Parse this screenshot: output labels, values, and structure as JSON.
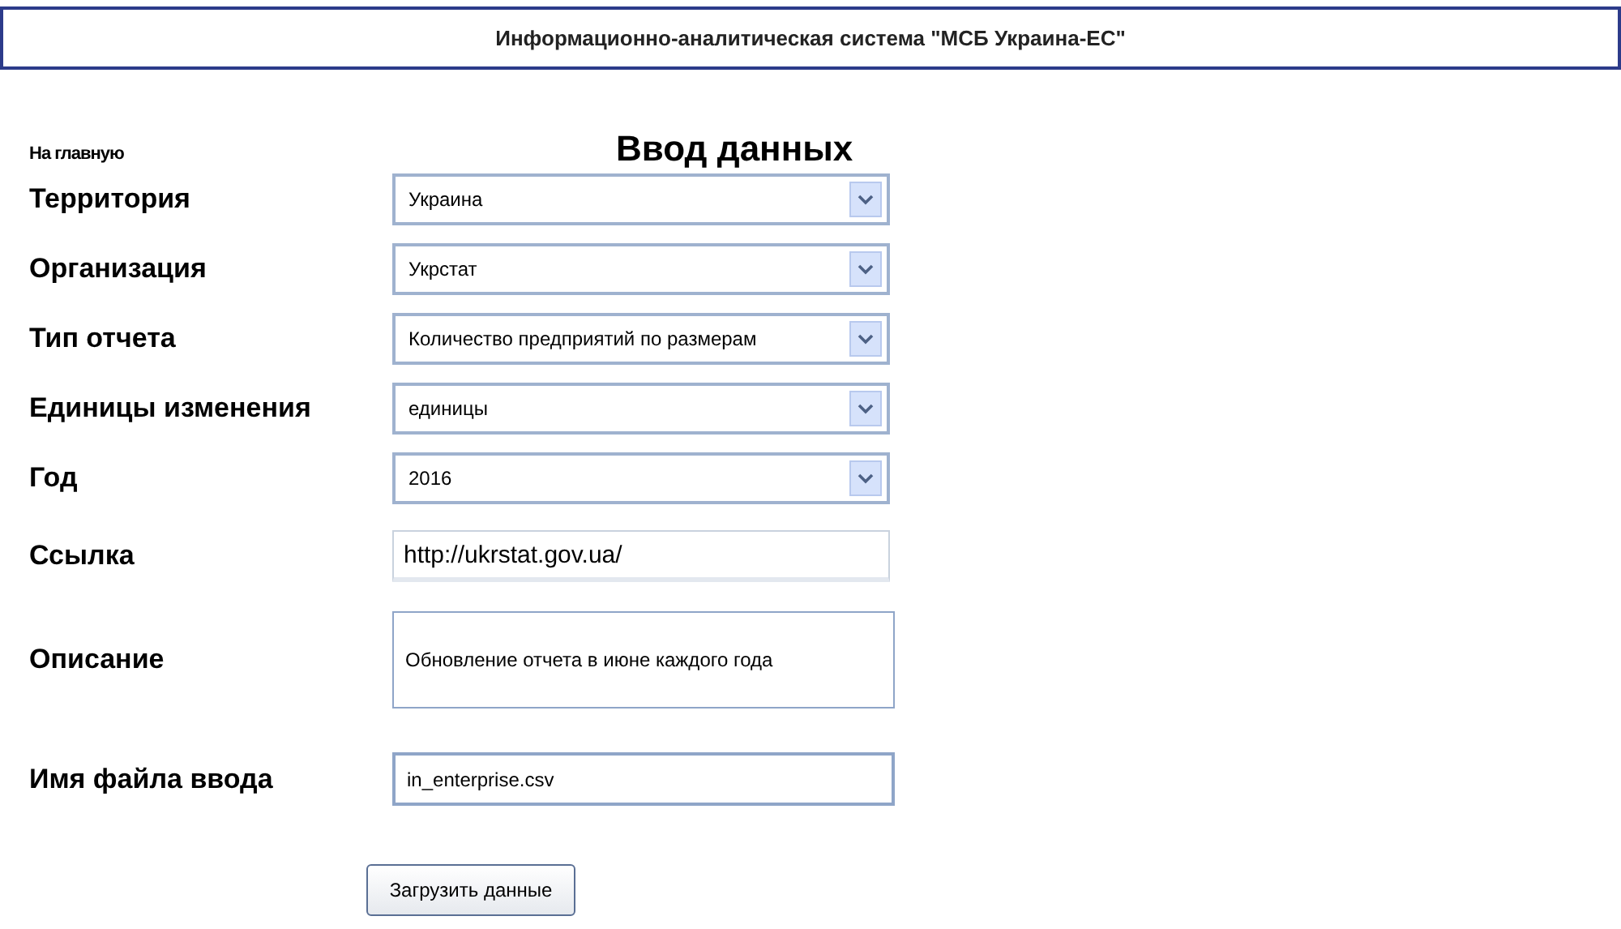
{
  "header": {
    "title": "Информационно-аналитическая система \"МСБ Украина-ЕС\""
  },
  "home_link": "На главную",
  "page_title": "Ввод данных",
  "fields": [
    {
      "kind": "select",
      "label": "Территория",
      "value": "Украина"
    },
    {
      "kind": "select",
      "label": "Организация",
      "value": "Укрстат"
    },
    {
      "kind": "select",
      "label": "Тип отчета",
      "value": "Количество предприятий по размерам"
    },
    {
      "kind": "select",
      "label": "Единицы изменения",
      "value": "единицы"
    },
    {
      "kind": "select",
      "label": "Год",
      "value": "2016"
    },
    {
      "kind": "text",
      "label": "Ссылка",
      "value": "http://ukrstat.gov.ua/"
    },
    {
      "kind": "textarea",
      "label": "Описание",
      "value": "Обновление отчета в июне каждого года"
    },
    {
      "kind": "file",
      "label": "Имя файла ввода",
      "value": "in_enterprise.csv"
    }
  ],
  "submit_button": "Загрузить данные"
}
